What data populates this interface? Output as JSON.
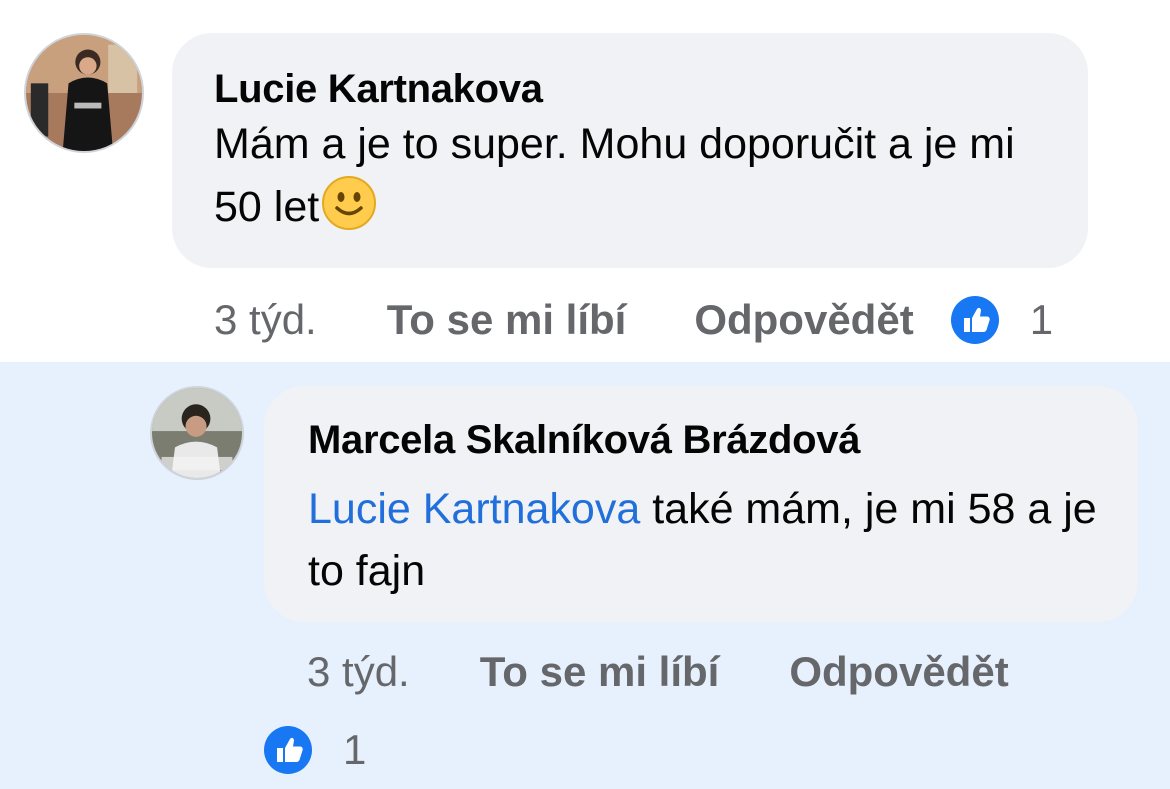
{
  "comment": {
    "author": "Lucie Kartnakova",
    "text": "Mám a je to super. Mohu doporučit a je mi 50 let",
    "emoji": "slightly-smiling-face-icon",
    "time": "3 týd.",
    "like_label": "To se mi líbí",
    "reply_label": "Odpovědět",
    "reaction_count": "1"
  },
  "reply": {
    "author": "Marcela Skalníková Brázdová",
    "mention": "Lucie Kartnakova",
    "text": " také mám, je mi 58 a je to fajn",
    "time": "3 týd.",
    "like_label": "To se mi líbí",
    "reply_label": "Odpovědět",
    "reaction_count": "1"
  },
  "colors": {
    "like_blue": "#1877f2",
    "mention_blue": "#216fdb",
    "reply_background": "#e7f0fd",
    "bubble": "#f0f2f5"
  }
}
